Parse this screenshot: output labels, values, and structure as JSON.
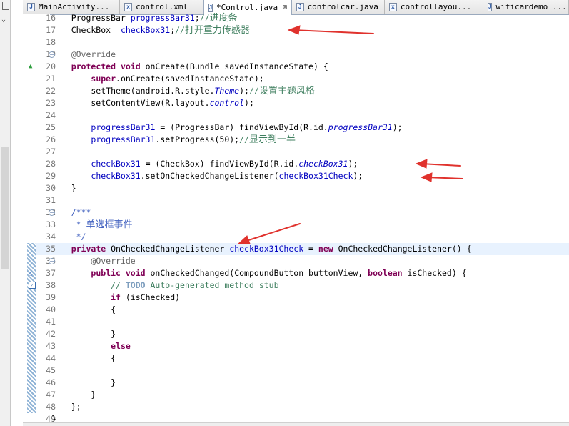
{
  "tabs": [
    {
      "label": "MainActivity...",
      "icon": "J"
    },
    {
      "label": "control.xml",
      "icon": "x"
    },
    {
      "label": "*Control.java",
      "icon": "J",
      "active": true,
      "close": "⊠"
    },
    {
      "label": "controlcar.java",
      "icon": "J"
    },
    {
      "label": "controllayou...",
      "icon": "x"
    },
    {
      "label": "wificardemo ...",
      "icon": "J"
    }
  ],
  "lines": [
    {
      "n": "16",
      "html": "    ProgressBar <span class=\"fld\">progressBar31</span>;<span class=\"cmt\">//<span class=\"cjk\">进度条</span></span>"
    },
    {
      "n": "17",
      "html": "    CheckBox  <span class=\"fld\">checkBox31</span>;<span class=\"cmt\">//<span class=\"cjk\">打开重力传感器</span></span>"
    },
    {
      "n": "18",
      "html": ""
    },
    {
      "n": "19",
      "fold": "−",
      "html": "    <span class=\"ann\">@Override</span>"
    },
    {
      "n": "20",
      "marker": "green",
      "html": "    <span class=\"kw\">protected</span> <span class=\"kw\">void</span> onCreate(Bundle savedInstanceState) {"
    },
    {
      "n": "21",
      "html": "        <span class=\"kw\">super</span>.onCreate(savedInstanceState);"
    },
    {
      "n": "22",
      "html": "        setTheme(android.R.style.<span class=\"sfi\">Theme</span>);<span class=\"cmt\">//<span class=\"cjk\">设置主题风格</span></span>"
    },
    {
      "n": "23",
      "html": "        setContentView(R.layout.<span class=\"sfi\">control</span>);"
    },
    {
      "n": "24",
      "html": ""
    },
    {
      "n": "25",
      "html": "        <span class=\"fld\">progressBar31</span> = (ProgressBar) findViewById(R.id.<span class=\"sfi\">progressBar31</span>);"
    },
    {
      "n": "26",
      "html": "        <span class=\"fld\">progressBar31</span>.setProgress(50);<span class=\"cmt\">//<span class=\"cjk\">显示到一半</span></span>"
    },
    {
      "n": "27",
      "html": ""
    },
    {
      "n": "28",
      "html": "        <span class=\"fld\">checkBox31</span> = (CheckBox) findViewById(R.id.<span class=\"sfi\">checkBox31</span>);"
    },
    {
      "n": "29",
      "html": "        <span class=\"fld\">checkBox31</span>.setOnCheckedChangeListener(<span class=\"fld\">checkBox31Check</span>);"
    },
    {
      "n": "30",
      "html": "    }"
    },
    {
      "n": "31",
      "html": ""
    },
    {
      "n": "32",
      "fold": "−",
      "html": "    <span class=\"doc\">/***</span>"
    },
    {
      "n": "33",
      "html": "     <span class=\"doc\">* <span class=\"cjk\">单选框事件</span></span>"
    },
    {
      "n": "34",
      "html": "     <span class=\"doc\">*/</span>"
    },
    {
      "n": "35",
      "bar": true,
      "current": true,
      "html": "    <span class=\"kw\">private</span> OnCheckedChangeListener <span class=\"fld\">checkBox31Check</span> = <span class=\"kw\">new</span> OnCheckedChangeListener() {"
    },
    {
      "n": "36",
      "bar": true,
      "fold": "−",
      "html": "        <span class=\"ann\">@Override</span>"
    },
    {
      "n": "37",
      "bar": true,
      "marker": "tri",
      "html": "        <span class=\"kw\">public</span> <span class=\"kw\">void</span> onCheckedChanged(CompoundButton buttonView, <span class=\"kw\">boolean</span> isChecked) {"
    },
    {
      "n": "38",
      "bar": true,
      "marker": "task",
      "html": "            <span class=\"cmt\">// <span class=\"todo\">TODO</span> Auto-generated method stub</span>"
    },
    {
      "n": "39",
      "bar": true,
      "html": "            <span class=\"kw\">if</span> (isChecked)"
    },
    {
      "n": "40",
      "bar": true,
      "html": "            {"
    },
    {
      "n": "41",
      "bar": true,
      "html": ""
    },
    {
      "n": "42",
      "bar": true,
      "html": "            }"
    },
    {
      "n": "43",
      "bar": true,
      "html": "            <span class=\"kw\">else</span>"
    },
    {
      "n": "44",
      "bar": true,
      "html": "            {"
    },
    {
      "n": "45",
      "bar": true,
      "html": ""
    },
    {
      "n": "46",
      "bar": true,
      "html": "            }"
    },
    {
      "n": "47",
      "bar": true,
      "html": "        }"
    },
    {
      "n": "48",
      "bar": true,
      "html": "    };"
    },
    {
      "n": "49",
      "html": "}"
    }
  ],
  "colors": {
    "keyword": "#7f0055",
    "field": "#0000c0",
    "comment": "#3f7f5f",
    "javadoc": "#3f5fbf",
    "annotation": "#646464",
    "arrow": "#e0322d",
    "current_line": "#e8f2fe"
  }
}
